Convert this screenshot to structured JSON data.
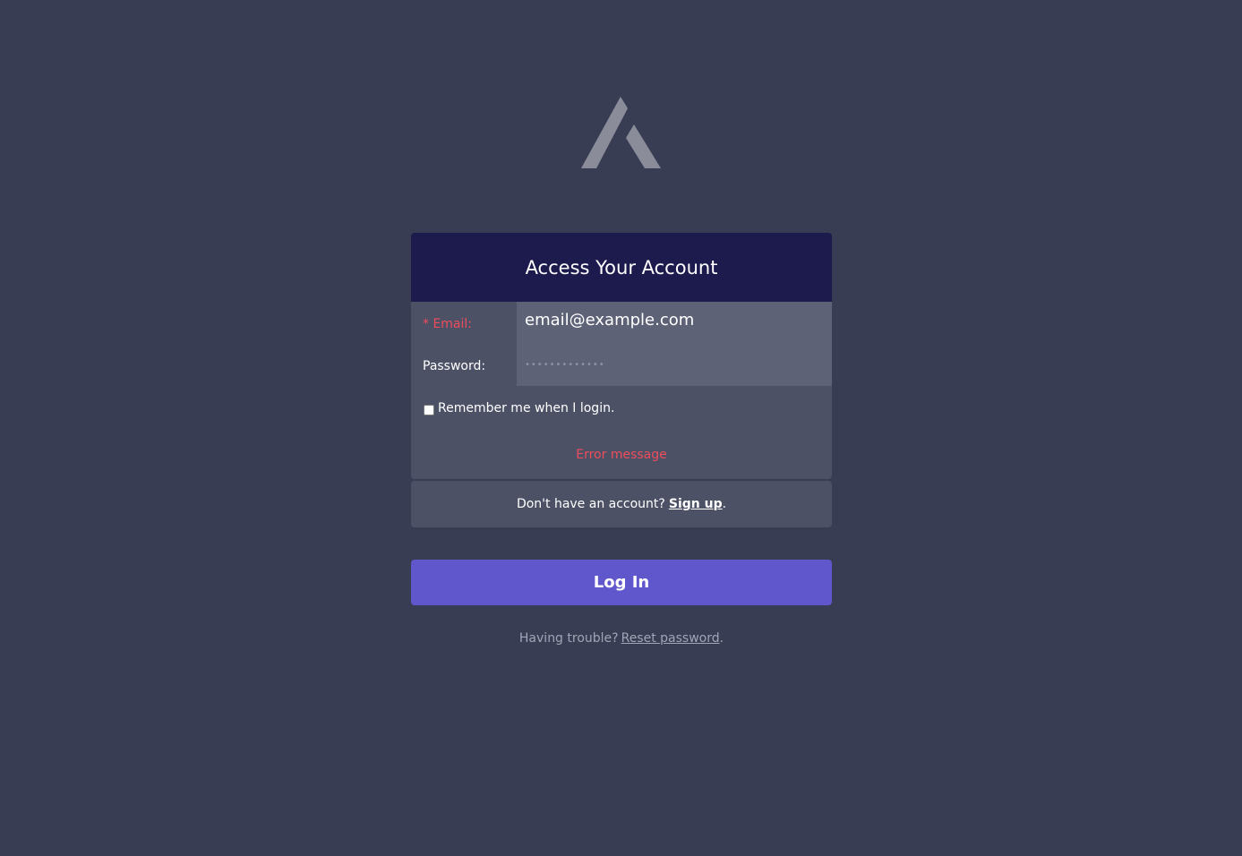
{
  "header": {
    "title": "Access Your Account"
  },
  "form": {
    "email_label": "* Email:",
    "email_value": "email@example.com",
    "password_label": "Password:",
    "password_value": "•••••••••••••",
    "remember_label": "Remember me when I login.",
    "remember_checked": false,
    "error_message": "Error message"
  },
  "signup": {
    "prompt": "Don't have an account?",
    "link": "Sign up",
    "suffix": "."
  },
  "login_button": {
    "label": "Log In"
  },
  "trouble": {
    "prompt": "Having trouble?",
    "link": "Reset password",
    "suffix": "."
  },
  "colors": {
    "background": "#383d53",
    "header": "#1d1a4e",
    "accent": "#6157cc",
    "error": "#ef4d5c"
  },
  "icons": {
    "logo": "mountain-a-logo"
  }
}
